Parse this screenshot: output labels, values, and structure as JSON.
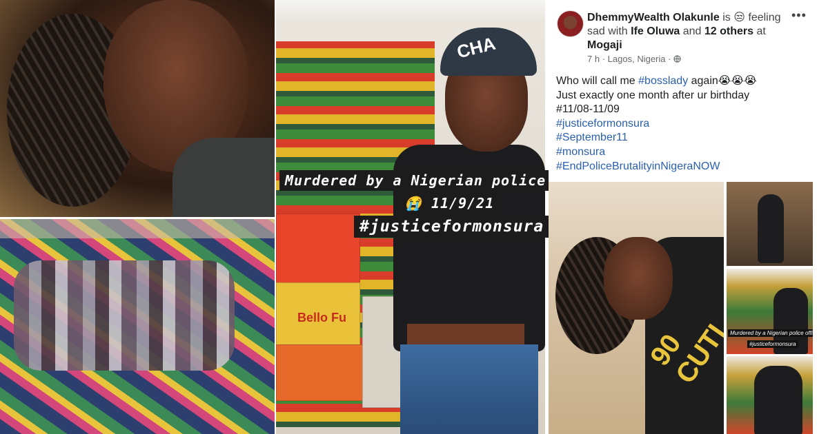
{
  "poster": {
    "cap_brand": "CHA",
    "caption_line1": "Murdered by a Nigerian police",
    "caption_line2": "😭 11/9/21",
    "caption_line3": "#justiceformonsura",
    "box_label": "Bello Fu"
  },
  "post": {
    "author": "DhemmyWealth Olakunle",
    "is_text": "is",
    "feeling_emoji": "😒",
    "feeling_text": "feeling sad with",
    "tagged_person": "Ife Oluwa",
    "and_text": "and",
    "others": "12 others",
    "at_text": "at",
    "place": "Mogaji",
    "time": "7 h",
    "location": "Lagos, Nigeria",
    "privacy_icon": "globe-icon",
    "more_label": "•••",
    "text_line1_prefix": "Who will call me ",
    "text_line1_tag": "#bosslady",
    "text_line1_suffix": " again😭😭😭",
    "text_line2": "Just exactly one month after ur birthday",
    "text_line3": "#11/08-11/09",
    "hashtags": [
      "#justiceformonsura",
      "#September11",
      "#monsura",
      "#EndPoliceBrutalityinNigeraNOW"
    ]
  },
  "photos": {
    "main_shirt_text": "90 CUTI",
    "thumb2_caption": "Murdered by a Nigerian police officer",
    "thumb2_caption2": "#justiceformonsura"
  }
}
